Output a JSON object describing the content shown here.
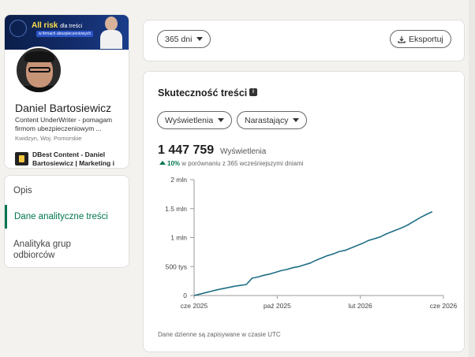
{
  "profile": {
    "banner_title": "All risk",
    "banner_title_small": "dla treści",
    "banner_sub": "w firmach ubezpieczeniowych",
    "name": "Daniel Bartosiewicz",
    "headline": "Content UnderWriter - pomagam firmom ubezpieczeniowym ...",
    "location": "Kwidzyn, Woj. Pomorskie",
    "company": "DBest Content - Daniel Bartosiewicz | Marketing i content dla ubezpieczeń"
  },
  "nav": {
    "items": [
      {
        "label": "Opis"
      },
      {
        "label": "Dane analityczne treści"
      },
      {
        "label": "Analityka grup odbiorców"
      }
    ]
  },
  "toolbar": {
    "period_label": "365 dni",
    "export_label": "Eksportuj"
  },
  "content": {
    "title": "Skuteczność treści",
    "filter_metric": "Wyświetlenia",
    "filter_mode": "Narastający",
    "total_value": "1 447 759",
    "total_unit": "Wyświetlenia",
    "trend_pct": "10%",
    "trend_text": "w porównaniu z 365 wcześniejszymi dniami",
    "footnote": "Dane dzienne są zapisywane w czasie UTC"
  },
  "colors": {
    "accent": "#01754f",
    "line": "#1e6f86"
  },
  "chart_data": {
    "type": "line",
    "ylim": [
      0,
      2000000
    ],
    "y_ticks": [
      {
        "value": 0,
        "label": "0"
      },
      {
        "value": 500000,
        "label": "500 tys"
      },
      {
        "value": 1000000,
        "label": "1 mln"
      },
      {
        "value": 1500000,
        "label": "1.5 mln"
      },
      {
        "value": 2000000,
        "label": "2 mln"
      }
    ],
    "x_ticks": [
      "cze 2025",
      "paź 2025",
      "lut 2026",
      "cze 2026"
    ],
    "series": [
      {
        "values": [
          0,
          25000,
          50000,
          75000,
          100000,
          120000,
          140000,
          160000,
          175000,
          190000,
          300000,
          320000,
          350000,
          370000,
          400000,
          430000,
          450000,
          480000,
          500000,
          530000,
          560000,
          610000,
          650000,
          690000,
          720000,
          760000,
          780000,
          820000,
          860000,
          900000,
          950000,
          980000,
          1010000,
          1060000,
          1100000,
          1140000,
          1180000,
          1230000,
          1290000,
          1350000,
          1400000,
          1447759
        ]
      }
    ]
  }
}
